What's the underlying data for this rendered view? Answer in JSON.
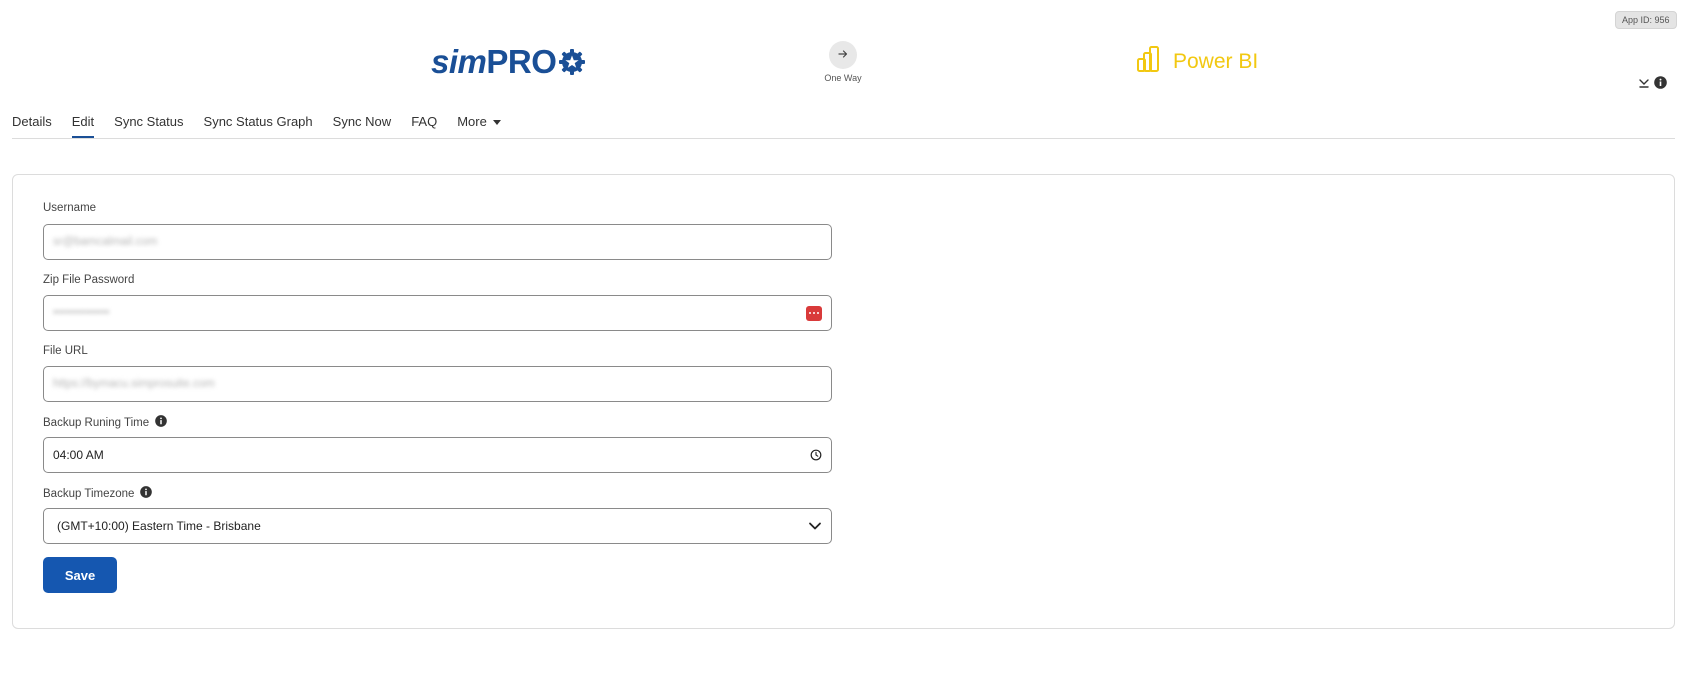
{
  "header": {
    "app_id": "App ID: 956",
    "source_app": {
      "name_part1": "sim",
      "name_part2": "PRO",
      "color": "#1a4f96",
      "icon": "gear-icon"
    },
    "flow": {
      "label": "One Way",
      "icon": "arrow-right-icon"
    },
    "target_app": {
      "name": "Power BI",
      "color": "#f2c811",
      "icon": "power-bi-icon"
    },
    "actions": [
      {
        "icon": "collapse-icon"
      },
      {
        "icon": "info-icon"
      }
    ]
  },
  "tabs": [
    {
      "label": "Details",
      "active": false
    },
    {
      "label": "Edit",
      "active": true
    },
    {
      "label": "Sync Status",
      "active": false
    },
    {
      "label": "Sync Status Graph",
      "active": false
    },
    {
      "label": "Sync Now",
      "active": false
    },
    {
      "label": "FAQ",
      "active": false
    },
    {
      "label": "More",
      "active": false,
      "dropdown": true
    }
  ],
  "form": {
    "username": {
      "label": "Username",
      "value": "sr@bamcalmail.com"
    },
    "zip_password": {
      "label": "Zip File Password",
      "value": "••••••••••••••",
      "icon": "password-manager-icon"
    },
    "file_url": {
      "label": "File URL",
      "value": "https://bymacu.simprosuite.com"
    },
    "backup_time": {
      "label": "Backup Runing Time",
      "value": "04:00 AM",
      "icon": "clock-icon",
      "info_icon": "info-icon"
    },
    "backup_timezone": {
      "label": "Backup Timezone",
      "value": "(GMT+10:00) Eastern Time - Brisbane",
      "icon": "chevron-down-icon",
      "info_icon": "info-icon"
    },
    "save_label": "Save"
  },
  "colors": {
    "accent": "#1557b0",
    "tab_underline": "#1a4f96",
    "password_badge": "#d93a3a"
  }
}
